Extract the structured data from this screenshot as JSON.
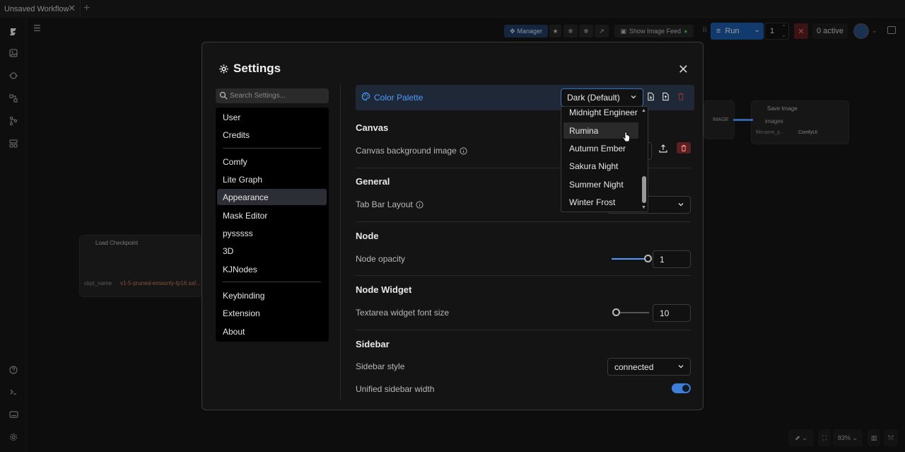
{
  "tabs": [
    {
      "label": "Unsaved Workflow"
    }
  ],
  "toolbar": {
    "manager_label": "Manager",
    "show_image_feed_label": "Show Image Feed",
    "run_label": "Run",
    "run_count": "1",
    "active_label": "0 active"
  },
  "canvas": {
    "load_checkpoint_title": "Load Checkpoint",
    "ckpt_name_label": "ckpt_name",
    "ckpt_name_value": "v1-5-pruned-emaonly-fp16.saf...",
    "save_image_title": "Save Image",
    "image_output_label": "IMAGE",
    "images_input_label": "images",
    "filename_prefix_label": "filename_p...",
    "filename_prefix_value": "ComfyUI",
    "zoom": "83%"
  },
  "settings": {
    "title": "Settings",
    "search_placeholder": "Search Settings...",
    "categories_group1": [
      "User",
      "Credits"
    ],
    "categories_group2": [
      "Comfy",
      "Lite Graph",
      "Appearance",
      "Mask Editor",
      "pysssss",
      "3D",
      "KJNodes"
    ],
    "categories_group3": [
      "Keybinding",
      "Extension",
      "About"
    ],
    "active_category": "Appearance",
    "color_palette": {
      "label": "Color Palette",
      "selected": "Dark (Default)",
      "options_visible": [
        "Midnight Engineer",
        "Rumina",
        "Autumn Ember",
        "Sakura Night",
        "Summer Night",
        "Winter Frost"
      ],
      "hovered": "Rumina"
    },
    "sections": {
      "canvas": {
        "title": "Canvas",
        "bg_image_label": "Canvas background image"
      },
      "general": {
        "title": "General",
        "tab_bar_layout_label": "Tab Bar Layout"
      },
      "node": {
        "title": "Node",
        "opacity_label": "Node opacity",
        "opacity_value": "1",
        "opacity_fraction": 1.0
      },
      "node_widget": {
        "title": "Node Widget",
        "textarea_font_label": "Textarea widget font size",
        "textarea_font_value": "10",
        "textarea_font_fraction": 0.0
      },
      "sidebar": {
        "title": "Sidebar",
        "style_label": "Sidebar style",
        "style_value": "connected",
        "unified_width_label": "Unified sidebar width",
        "unified_width_on": true
      }
    }
  },
  "colors": {
    "accent": "#4f9bff",
    "run_button": "#1e5aa8",
    "danger": "#b03a3a"
  }
}
